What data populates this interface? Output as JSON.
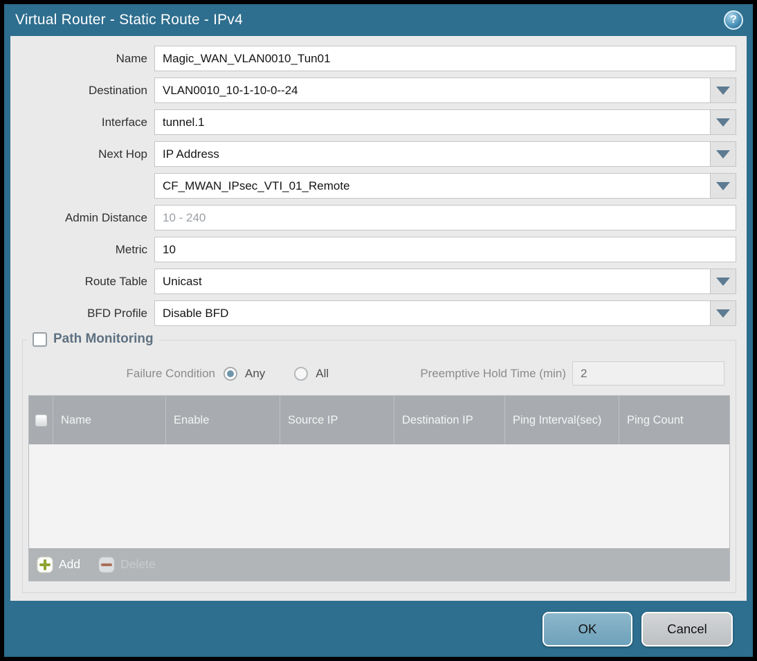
{
  "titlebar": {
    "title": "Virtual Router - Static Route - IPv4",
    "help": "?"
  },
  "form": {
    "name": {
      "label": "Name",
      "value": "Magic_WAN_VLAN0010_Tun01"
    },
    "destination": {
      "label": "Destination",
      "value": "VLAN0010_10-1-10-0--24"
    },
    "interface": {
      "label": "Interface",
      "value": "tunnel.1"
    },
    "next_hop": {
      "label": "Next Hop",
      "value": "IP Address"
    },
    "next_hop_address": {
      "value": "CF_MWAN_IPsec_VTI_01_Remote"
    },
    "admin_distance": {
      "label": "Admin Distance",
      "placeholder": "10 - 240"
    },
    "metric": {
      "label": "Metric",
      "value": "10"
    },
    "route_table": {
      "label": "Route Table",
      "value": "Unicast"
    },
    "bfd_profile": {
      "label": "BFD Profile",
      "value": "Disable BFD"
    }
  },
  "path_monitoring": {
    "title": "Path Monitoring",
    "failure_condition": {
      "label": "Failure Condition",
      "options": [
        {
          "label": "Any",
          "selected": true
        },
        {
          "label": "All",
          "selected": false
        }
      ]
    },
    "preemptive_hold_time": {
      "label": "Preemptive Hold Time (min)",
      "value": "2"
    },
    "table": {
      "headers": [
        "Name",
        "Enable",
        "Source IP",
        "Destination IP",
        "Ping Interval(sec)",
        "Ping Count"
      ],
      "rows": []
    },
    "toolbar": {
      "add": "Add",
      "delete": "Delete"
    }
  },
  "footer": {
    "ok": "OK",
    "cancel": "Cancel"
  },
  "colors": {
    "frame_teal": "#2e6e8e",
    "content_gray": "#eaeaea",
    "table_header_gray": "#a8acb0",
    "ok_button_blue": "#6da1bb",
    "add_icon_green": "#8da432",
    "delete_icon_red": "#a9705a",
    "radio_selected_teal": "#6e96ab"
  }
}
